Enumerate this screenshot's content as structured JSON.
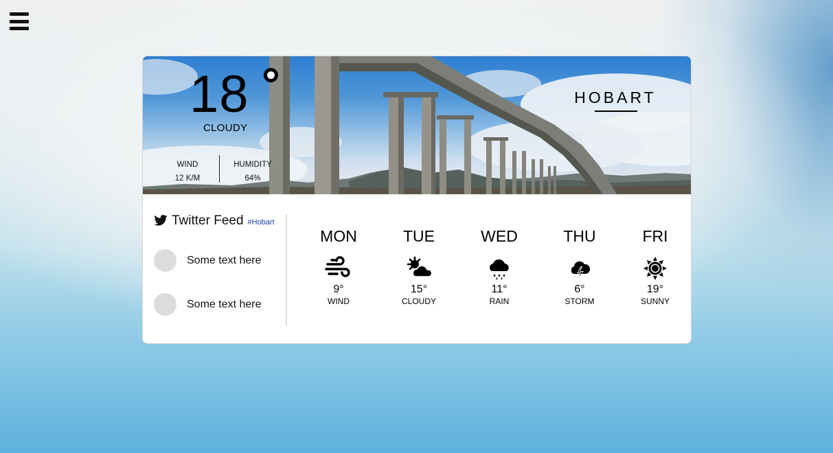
{
  "menu": {
    "icon": "hamburger-menu-icon"
  },
  "current": {
    "temperature": "18",
    "degree_symbol": "°",
    "condition": "CLOUDY",
    "wind_label": "WIND",
    "wind_value": "12 K/M",
    "humidity_label": "HUMIDITY",
    "humidity_value": "64%",
    "city": "HOBART"
  },
  "twitter": {
    "icon": "twitter-bird-icon",
    "title": "Twitter Feed",
    "hashtag": "#Hobart",
    "items": [
      {
        "text": "Some text here"
      },
      {
        "text": "Some text here"
      }
    ]
  },
  "forecast": [
    {
      "day": "MON",
      "temp": "9°",
      "condition": "WIND",
      "icon": "wind-icon"
    },
    {
      "day": "TUE",
      "temp": "15°",
      "condition": "CLOUDY",
      "icon": "sun-cloud-icon"
    },
    {
      "day": "WED",
      "temp": "11°",
      "condition": "RAIN",
      "icon": "rain-icon"
    },
    {
      "day": "THU",
      "temp": "6°",
      "condition": "STORM",
      "icon": "storm-icon"
    },
    {
      "day": "FRI",
      "temp": "19°",
      "condition": "SUNNY",
      "icon": "sun-icon"
    }
  ],
  "colors": {
    "hashtag": "#1a3fa8",
    "card_border": "#d6d6d6"
  }
}
